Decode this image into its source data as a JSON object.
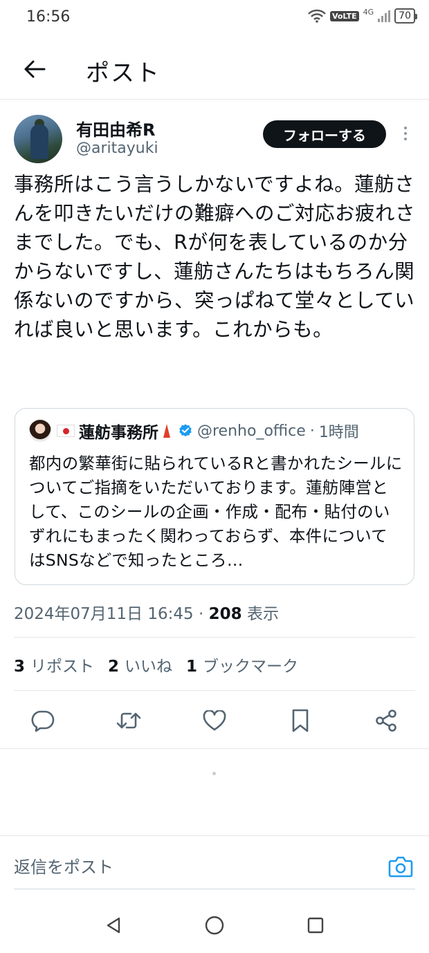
{
  "status_bar": {
    "time": "16:56",
    "network": "4G",
    "volte": "VoLTE",
    "battery": "70"
  },
  "header": {
    "title": "ポスト",
    "back_icon": "arrow-left-icon"
  },
  "post": {
    "author": {
      "display_name": "有田由希R",
      "username": "@aritayuki"
    },
    "follow_label": "フォローする",
    "text": "事務所はこう言うしかないですよね。蓮舫さんを叩きたいだけの難癖へのご対応お疲れさまでした。でも、Rが何を表しているのか分からないですし、蓮舫さんたちはもちろん関係ないのですから、突っぱねて堂々としていれば良いと思います。これからも。",
    "quote": {
      "display_name": "蓮舫事務所",
      "username": "@renho_office",
      "time": "1時間",
      "text": "都内の繁華街に貼られているRと書かれたシールについてご指摘をいただいております。蓮舫陣営として、このシールの企画・作成・配布・貼付のいずれにもまったく関わっておらず、本件についてはSNSなどで知ったところ…"
    },
    "meta": {
      "timestamp": "2024年07月11日 16:45",
      "separator": "·",
      "views_count": "208",
      "views_label": "表示"
    },
    "stats": {
      "reposts_count": "3",
      "reposts_label": "リポスト",
      "likes_count": "2",
      "likes_label": "いいね",
      "bookmarks_count": "1",
      "bookmarks_label": "ブックマーク"
    },
    "actions": [
      "reply-icon",
      "repost-icon",
      "like-icon",
      "bookmark-icon",
      "share-icon"
    ]
  },
  "reply": {
    "placeholder": "返信をポスト"
  },
  "colors": {
    "accent": "#1d9bf0",
    "text": "#0f1419",
    "secondary": "#536471",
    "border": "#cfd9de"
  }
}
